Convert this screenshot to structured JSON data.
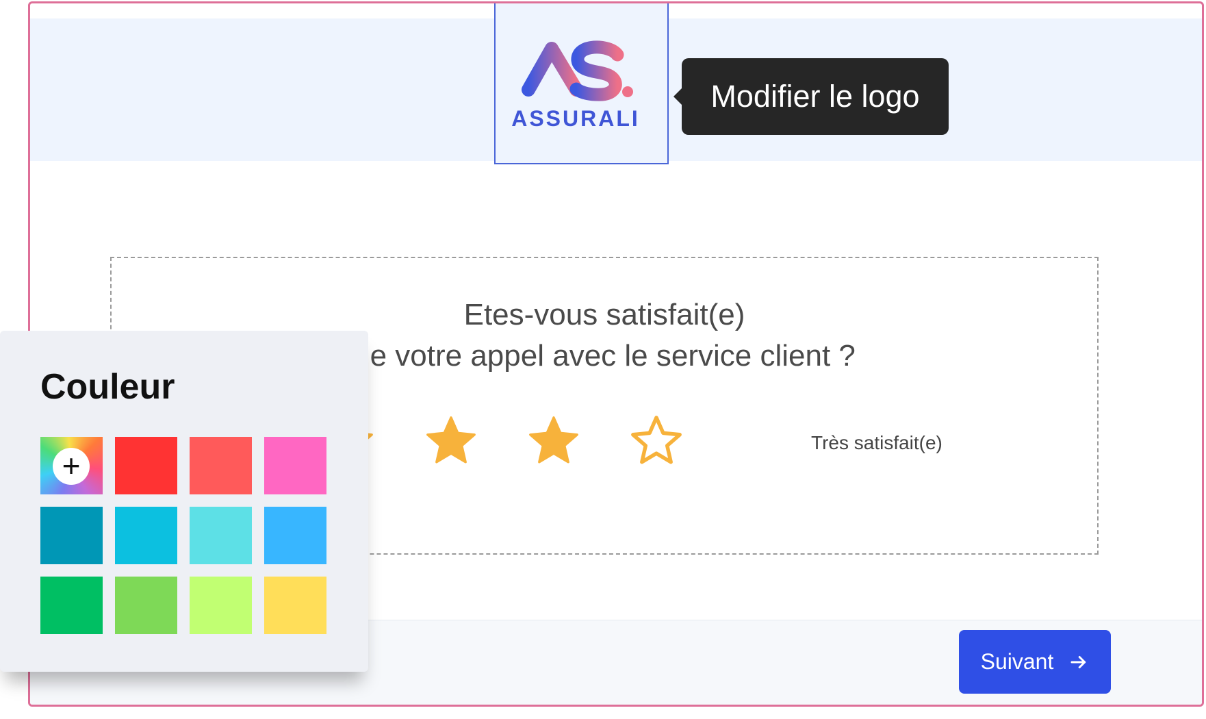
{
  "header": {
    "logo": {
      "monogram": "AS.",
      "brand_name": "ASSURALI",
      "colors": {
        "gradient_start": "#3c58e0",
        "gradient_end": "#ee7088",
        "dot": "#ee7088",
        "brand_text": "#3f55d6"
      }
    },
    "tooltip_text": "Modifier le logo"
  },
  "survey": {
    "question_line1": "Etes-vous satisfait(e)",
    "question_line2": "de votre appel avec le service client ?",
    "rating": {
      "value": 4,
      "max": 5,
      "filled_color": "#f7b23b",
      "empty_color": "#f7b23b"
    },
    "max_label": "Très satisfait(e)"
  },
  "footer": {
    "next_label": "Suivant",
    "next_icon": "arrow-right-icon",
    "next_color": "#2f4fe6"
  },
  "color_panel": {
    "title": "Couleur",
    "custom_icon": "plus-icon",
    "custom_symbol": "+",
    "swatches": [
      "#ff3333",
      "#ff5a5a",
      "#ff67c2",
      "#0097b6",
      "#0cc0e0",
      "#5de0e6",
      "#38b6ff",
      "#00bf63",
      "#7ed957",
      "#c1ff72",
      "#ffde59"
    ]
  },
  "accent_colors": {
    "frame_border": "#de6f98",
    "logo_selection_border": "#4a66d8"
  }
}
